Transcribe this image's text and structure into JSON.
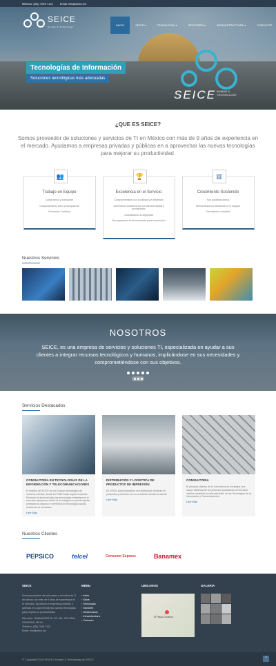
{
  "topbar": {
    "phone": "Teléfono: (55)) 7049 7122",
    "email": "Email: info@seice.mx"
  },
  "logo": {
    "name": "SEICE",
    "tagline": "Human & Technology"
  },
  "menu": [
    "INICIO",
    "SEICE",
    "TECNOLOGÍA",
    "SECTORES",
    "INFRAESTRUCTURA",
    "CONTACTO"
  ],
  "menu_arrow": "▾",
  "hero": {
    "title": "Tecnologías de Información",
    "subtitle": "Soluciones tecnológicas más adecuadas",
    "brand": "SEICE",
    "brand_tag": "HUMAN & TECHNOLOGY"
  },
  "about": {
    "title": "¿QUE ES SEICE?",
    "text": "Somos proveedor de soluciones y servicios de TI en México con más de 9 años de experiencia en el mercado. Ayudamos a empresas privadas y públicas en a aprovechar las nuevas tecnologías para mejorar su productividad."
  },
  "cards": [
    {
      "icon": "users-icon",
      "glyph": "👥",
      "title": "Trabajo en Equipo",
      "items": [
        "Compromiso y motivación",
        "Comportamiento ético y transparente",
        "Formación Continua"
      ]
    },
    {
      "icon": "trophy-icon",
      "glyph": "🏆",
      "title": "Excelencia en el Servicio",
      "items": [
        "Compromentidos con la calidad y el eficiencia",
        "Generamos confianza con los clientes lealtad y proveedores",
        "Garantizamos la seguridad",
        "Nos apoyamos en la innovación para la evolución"
      ]
    },
    {
      "icon": "chart-icon",
      "glyph": "▥",
      "title": "Crecimiento Sostenido",
      "items": [
        "Nos autofinanciamos",
        "Reinvertimos los beneficios en el negocio",
        "Crecimiento constante"
      ]
    }
  ],
  "services_title": "Nuestros Servicios",
  "nosotros": {
    "title": "NOSOTROS",
    "text": "SEICE, es una empresa de servicios y soluciones TI, especializada en ayudar a sus clientes a integrar recursos tecnológicos y humanos, implicándose en sus necesidades y comprometiéndose con sus objetivos."
  },
  "featured_title": "Servicios Destacados",
  "featured": [
    {
      "title": "CONSULTORÍA EN TECNOLOGÍAS DE LA INFORMACIÓN Y TELECOMUNICACIONES",
      "text": "El objetivo de SEICE es ser el apoyo tecnológico de nuestros clientes, desde la PYME hasta la gran empresa. Ponemos al alcance todas las tecnologías existentes en el mercado, apoyamos donde la tecnología nos puede ayudar a mejorar su negocio e invertimos en tecnología cuando realmente es necesaria.",
      "link": "Leer Más"
    },
    {
      "title": "DISTRIBUCIÓN Y LOGÍSTICA DE PRODUCTOS DE IMPRESIÓN",
      "text": "En SEICE proporcionamos una distribución eficiente de productos y servicios con un excelente servicio al cliente.",
      "link": "Leer Más"
    },
    {
      "title": "CONSULTORIA",
      "text": "El principal objetivo de la Consultoría es conseguir una mayor eficiencia de los procesos productivos de nuestros clientes mediante la externalización de las Tecnologías de la Información y Comunicaciones.",
      "link": "Leer Más"
    }
  ],
  "clients_title": "Nuestros Clientes",
  "clients": [
    "PEPSICO",
    "telcel",
    "Consumo Express",
    "Banamex"
  ],
  "footer": {
    "col1_title": "SEICE",
    "col1_text": "Somos proveedor de soluciones y servicios de TI en México con más de 9 años de experiencia en el mercado. Ayudamos a empresas privadas y públicas en a aprovechar las nuevas tecnologías para mejorar su productividad.",
    "address": "Dirección: TAMAULIPAS 26, OF. 401, COLONIA CONDESA, 06140",
    "phone": "Teléfono: (55)) 7049 7122",
    "email": "Email: info@seice.mx",
    "col2_title": "MENU",
    "menu": [
      "Inicio",
      "Seice",
      "Tecnología",
      "Sectores",
      "Gestionados",
      "Infraestructura",
      "Contacto"
    ],
    "col3_title": "UBICANOS",
    "map_label": "El Plaza Condesa",
    "col4_title": "GALERIA"
  },
  "copyright": "© Copyright 2016 SEICE | Human & Technology by SEICE",
  "totop": "^"
}
